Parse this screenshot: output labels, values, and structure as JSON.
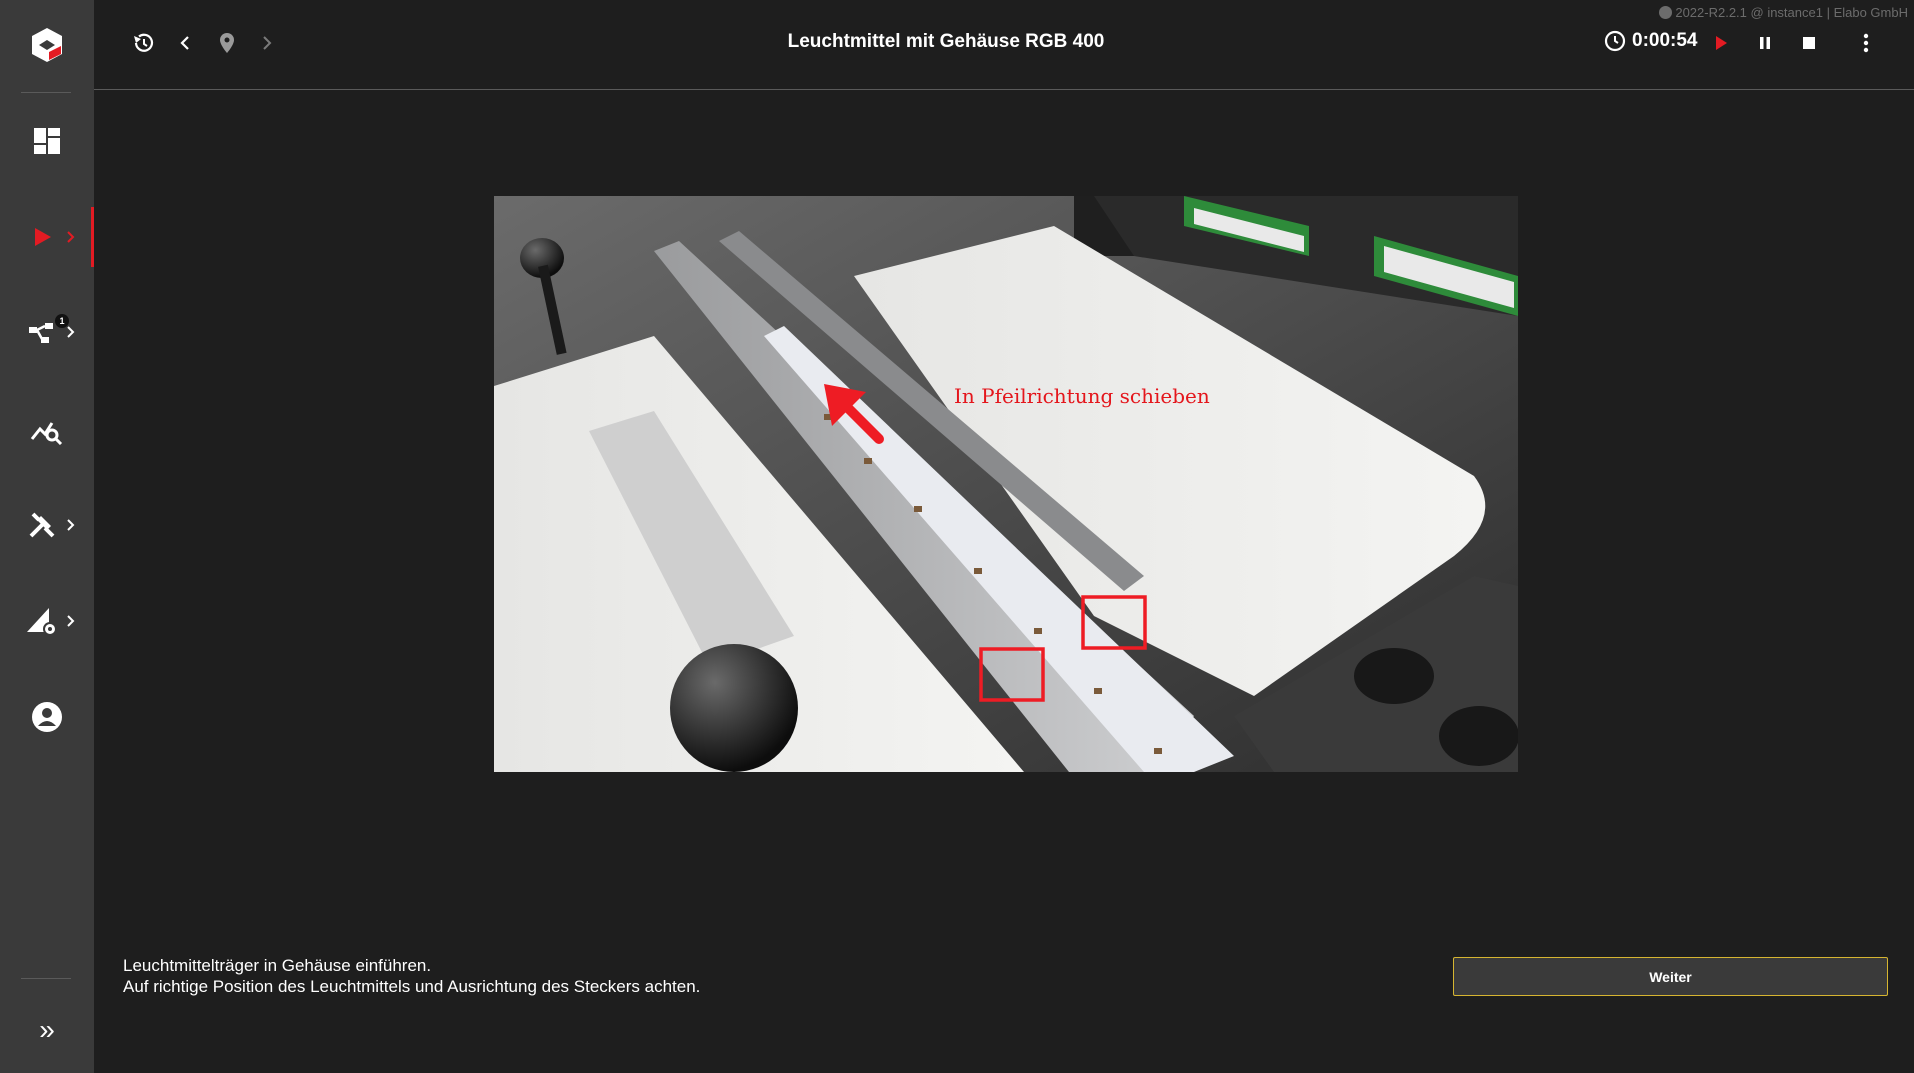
{
  "app": {
    "version_text": "2022-R2.2.1 @ instance1 | Elabo GmbH"
  },
  "sidebar": {
    "items": [
      {
        "name": "dashboard",
        "icon": "dashboard-icon"
      },
      {
        "name": "execution",
        "icon": "play-icon",
        "active": true
      },
      {
        "name": "workflow",
        "icon": "workflow-icon",
        "badge": "1"
      },
      {
        "name": "analysis",
        "icon": "analytics-search-icon"
      },
      {
        "name": "tools",
        "icon": "tools-icon"
      },
      {
        "name": "design",
        "icon": "design-settings-icon"
      },
      {
        "name": "account",
        "icon": "account-icon"
      }
    ],
    "expand_label": "»",
    "accent_color": "#e31b23"
  },
  "header": {
    "title": "Leuchtmittel mit Gehäuse RGB 400",
    "timer": "0:00:54"
  },
  "step": {
    "image_annotation": "In Pfeilrichtung schieben",
    "instruction_line1": "Leuchtmittelträger in Gehäuse einführen.",
    "instruction_line2": "Auf richtige Position des Leuchtmittels und Ausrichtung des Steckers achten.",
    "next_button": "Weiter",
    "button_border_color": "#d6b531"
  }
}
